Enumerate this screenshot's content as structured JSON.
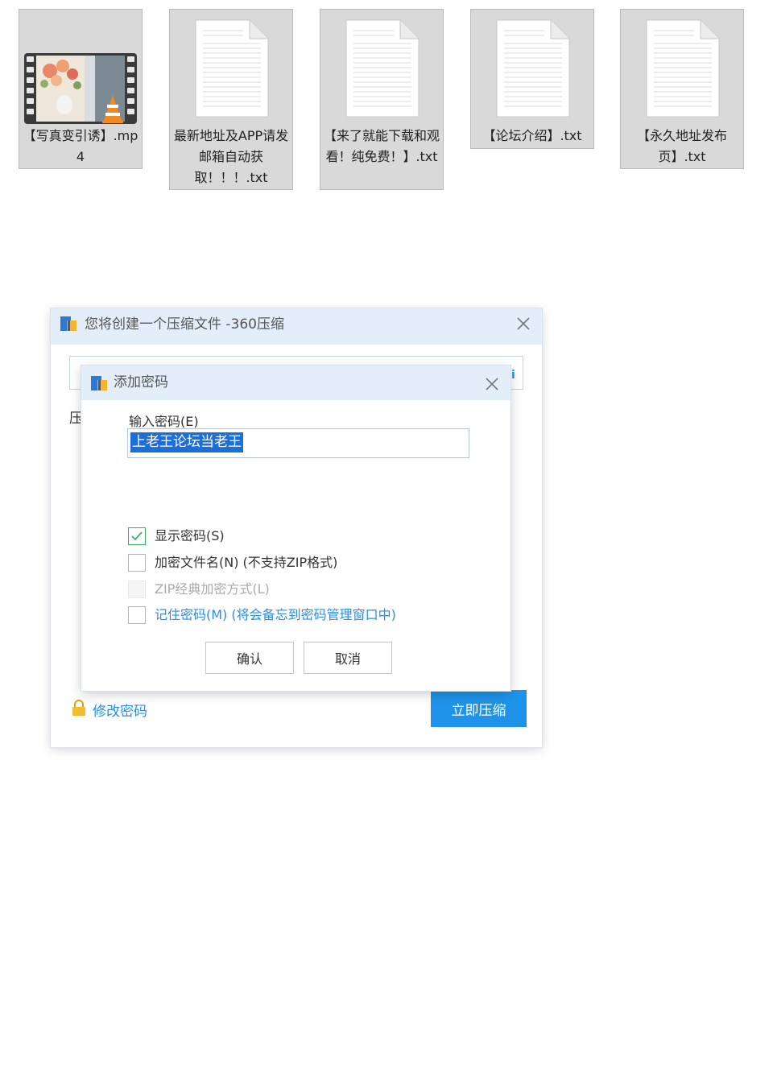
{
  "files": [
    {
      "name": "【写真变引诱】.mp4",
      "kind": "video",
      "icon": "video-thumbnail-icon"
    },
    {
      "name": "最新地址及APP请发邮箱自动获取！！！.txt",
      "kind": "txt",
      "icon": "text-document-icon"
    },
    {
      "name": "【来了就能下载和观看！纯免费！】.txt",
      "kind": "txt",
      "icon": "text-document-icon"
    },
    {
      "name": "【论坛介绍】.txt",
      "kind": "txt",
      "icon": "text-document-icon"
    },
    {
      "name": "【永久地址发布页】.txt",
      "kind": "txt",
      "icon": "text-document-icon"
    }
  ],
  "window": {
    "title": "您将创建一个压缩文件 -360压缩",
    "icon": "archive-app-icon",
    "path_button_hint": "i",
    "compress_label": "压",
    "modify_password_link": "修改密码",
    "compress_now_button": "立即压缩"
  },
  "dialog": {
    "title": "添加密码",
    "password_label": "输入密码(E)",
    "password_value": "上老王论坛当老王",
    "options": [
      {
        "label": "显示密码(S)",
        "checked": true,
        "disabled": false,
        "style": "normal"
      },
      {
        "label": "加密文件名(N) (不支持ZIP格式)",
        "checked": false,
        "disabled": false,
        "style": "normal"
      },
      {
        "label": "ZIP经典加密方式(L)",
        "checked": false,
        "disabled": true,
        "style": "disabled"
      },
      {
        "label": "记住密码(M) (将会备忘到密码管理窗口中)",
        "checked": false,
        "disabled": false,
        "style": "link"
      }
    ],
    "confirm_button": "确认",
    "cancel_button": "取消"
  },
  "colors": {
    "titlebar_bg": "#e3eefa",
    "accent_blue": "#1f93ea",
    "link_blue": "#2a8ee8",
    "check_green": "#36b36a",
    "selection_blue": "#1e6ed8",
    "tile_bg": "#d9d9d9"
  }
}
